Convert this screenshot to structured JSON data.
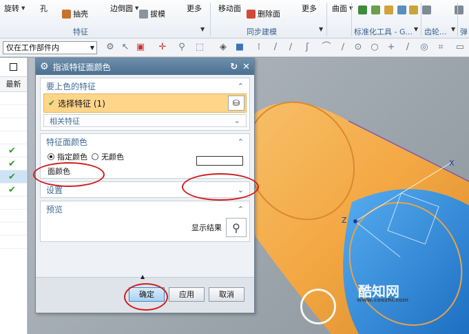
{
  "ribbon": {
    "row1": [
      "旋转",
      "孔",
      "边倒圆",
      "更多",
      "移动面",
      "更多",
      "曲面"
    ],
    "row2": [
      "抽壳",
      "拔模",
      "删除面"
    ],
    "groups": [
      "特征",
      "同步建模",
      "标准化工具 - G...",
      "齿轮...",
      "弹"
    ]
  },
  "filter": {
    "value": "仅在工作部件内"
  },
  "navigator": {
    "column": "最新"
  },
  "dialog": {
    "title": "指派特征面颜色",
    "sec_features": "要上色的特征",
    "select_feature": "选择特征 (1)",
    "related": "相关特征",
    "sec_color": "特征面颜色",
    "opt_specify": "指定颜色",
    "opt_none": "无颜色",
    "face_color": "面颜色",
    "sec_settings": "设置",
    "sec_preview": "预览",
    "show_result": "显示结果",
    "ok": "确定",
    "apply": "应用",
    "cancel": "取消"
  },
  "watermark": {
    "brand": "酷知网",
    "url": "www.coozhi.com"
  },
  "colors": {
    "cylinder_orange": "#f3a843",
    "cylinder_blue": "#2e8fe0",
    "annotation_red": "#d11b1b",
    "dialog_title": "#5a7d9e"
  }
}
